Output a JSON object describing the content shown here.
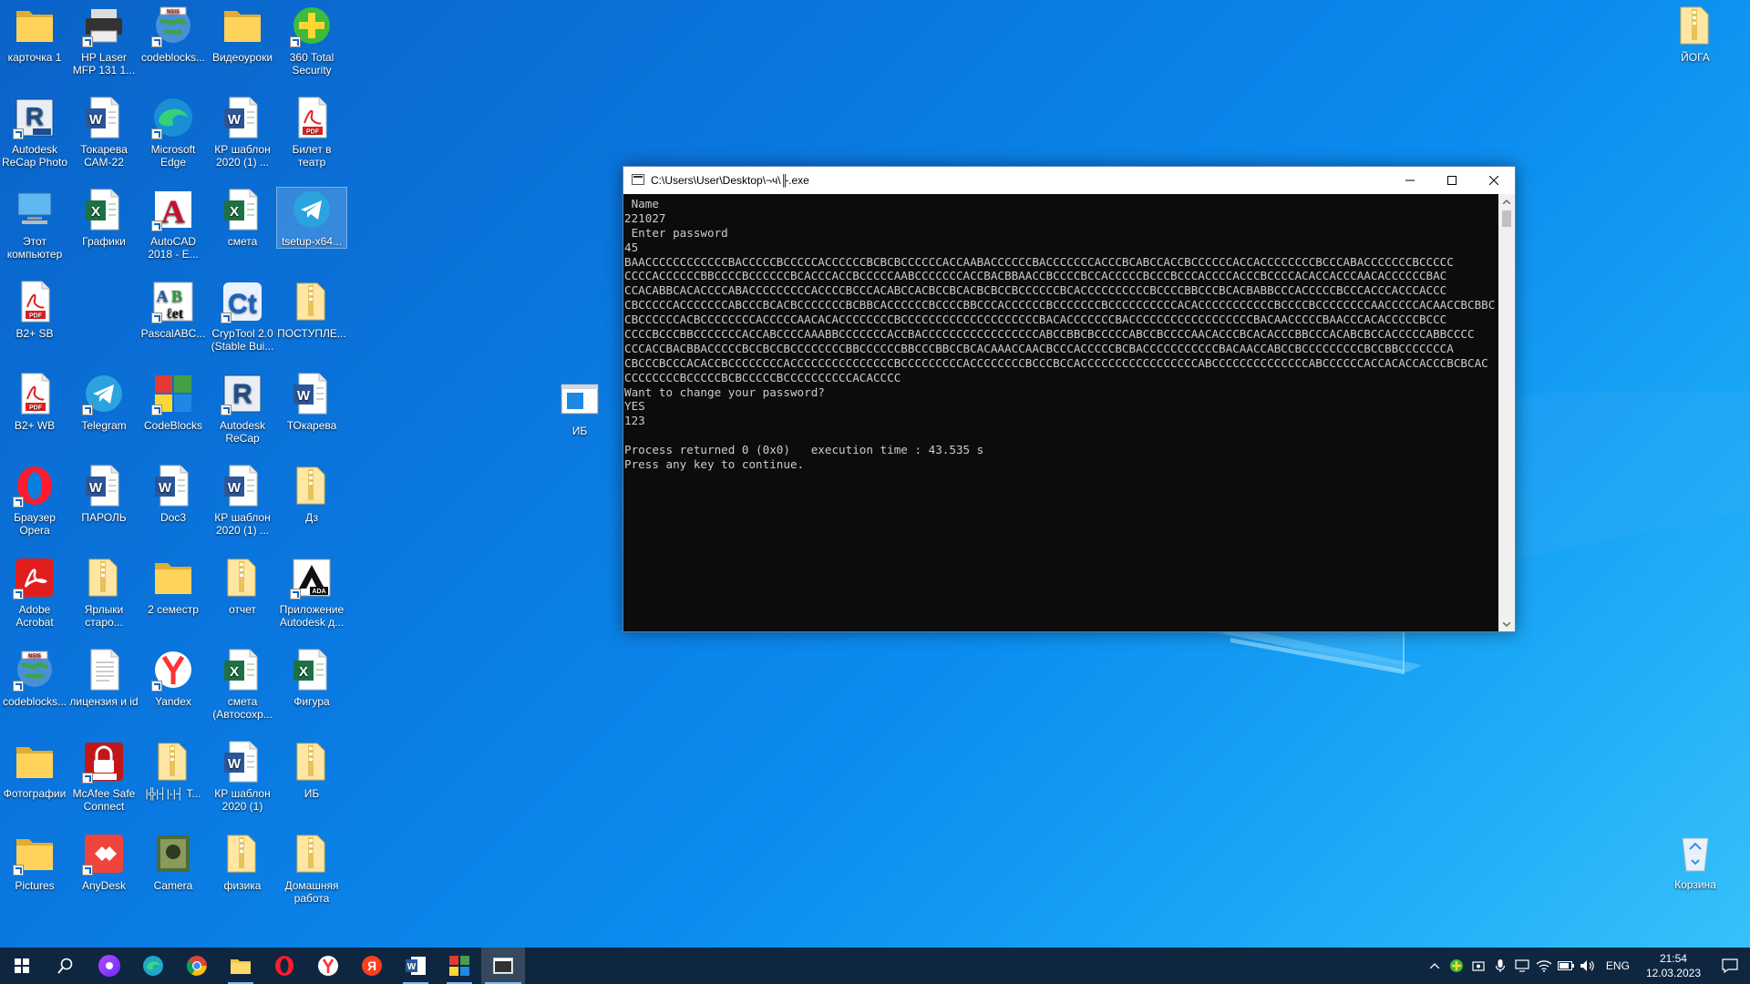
{
  "desktop": {
    "icons": [
      {
        "label": "карточка 1",
        "icon": "folder-icon",
        "shortcut": false
      },
      {
        "label": "HP Laser MFP 131 1...",
        "icon": "printer-icon",
        "shortcut": true
      },
      {
        "label": "codeblocks...",
        "icon": "globe-icon",
        "shortcut": true
      },
      {
        "label": "Видеоуроки",
        "icon": "folder-icon",
        "shortcut": false
      },
      {
        "label": "360 Total Security",
        "icon": "security-360-icon",
        "shortcut": true
      },
      {
        "label": "Autodesk ReCap Photo",
        "icon": "recap-photo-icon",
        "shortcut": true
      },
      {
        "label": "Токарева САМ-22",
        "icon": "word-doc-icon",
        "shortcut": false
      },
      {
        "label": "Microsoft Edge",
        "icon": "edge-icon",
        "shortcut": true
      },
      {
        "label": "КР шаблон 2020 (1) ...",
        "icon": "word-doc-icon",
        "shortcut": false
      },
      {
        "label": "Билет в театр",
        "icon": "pdf-icon",
        "shortcut": false
      },
      {
        "label": "Этот компьютер",
        "icon": "this-pc-icon",
        "shortcut": false
      },
      {
        "label": "Графики",
        "icon": "excel-icon",
        "shortcut": false
      },
      {
        "label": "AutoCAD 2018 - Е...",
        "icon": "autocad-icon",
        "shortcut": true
      },
      {
        "label": "смета",
        "icon": "excel-icon",
        "shortcut": false
      },
      {
        "label": "tsetup-x64...",
        "icon": "telegram-icon",
        "shortcut": false
      },
      {
        "label": "В2+ SB",
        "icon": "pdf-icon",
        "shortcut": false
      },
      {
        "label": "PascalABC...",
        "icon": "pascal-icon",
        "shortcut": true
      },
      {
        "label": "CrypTool 2.0 (Stable Bui...",
        "icon": "cryptool-icon",
        "shortcut": true
      },
      {
        "label": "ПОСТУПЛЕ...",
        "icon": "zip-folder-icon",
        "shortcut": false
      },
      {
        "label": "В2+ WB",
        "icon": "pdf-icon",
        "shortcut": false
      },
      {
        "label": "Telegram",
        "icon": "telegram-icon",
        "shortcut": true
      },
      {
        "label": "CodeBlocks",
        "icon": "codeblocks-icon",
        "shortcut": true
      },
      {
        "label": "Autodesk ReCap",
        "icon": "recap-icon",
        "shortcut": true
      },
      {
        "label": "ТОкарева",
        "icon": "word-doc-icon",
        "shortcut": false
      },
      {
        "label": "ИБ",
        "icon": "window-icon",
        "shortcut": false
      },
      {
        "label": "Браузер Opera",
        "icon": "opera-icon",
        "shortcut": true
      },
      {
        "label": "ПАРОЛЬ",
        "icon": "word-doc-icon",
        "shortcut": false
      },
      {
        "label": "Doc3",
        "icon": "word-doc-icon",
        "shortcut": false
      },
      {
        "label": "КР шаблон 2020 (1) ...",
        "icon": "word-doc-icon",
        "shortcut": false
      },
      {
        "label": "Дз",
        "icon": "zip-folder-icon",
        "shortcut": false
      },
      {
        "label": "Adobe Acrobat",
        "icon": "acrobat-icon",
        "shortcut": true
      },
      {
        "label": "Ярлыки старо...",
        "icon": "zip-folder-icon",
        "shortcut": false
      },
      {
        "label": "2 семестр",
        "icon": "folder-icon",
        "shortcut": false
      },
      {
        "label": "отчет",
        "icon": "zip-folder-icon",
        "shortcut": false
      },
      {
        "label": "Приложение Autodesk д...",
        "icon": "autodesk-app-icon",
        "shortcut": true
      },
      {
        "label": "codeblocks...",
        "icon": "globe-icon",
        "shortcut": true
      },
      {
        "label": "лицензия и id",
        "icon": "text-file-icon",
        "shortcut": false
      },
      {
        "label": "Yandex",
        "icon": "yandex-icon",
        "shortcut": true
      },
      {
        "label": "смета (Автосохр...",
        "icon": "excel-icon",
        "shortcut": false
      },
      {
        "label": "Фигура",
        "icon": "excel-icon",
        "shortcut": false
      },
      {
        "label": "Фотографии",
        "icon": "folder-icon",
        "shortcut": false
      },
      {
        "label": "McAfee Safe Connect",
        "icon": "mcafee-icon",
        "shortcut": true
      },
      {
        "label": "|╬|┤|-|┤ T...",
        "icon": "zip-folder-icon",
        "shortcut": false
      },
      {
        "label": "КР шаблон 2020 (1)",
        "icon": "word-doc-icon",
        "shortcut": false
      },
      {
        "label": "ИБ",
        "icon": "zip-folder-icon",
        "shortcut": false
      },
      {
        "label": "Pictures",
        "icon": "folder-icon",
        "shortcut": true
      },
      {
        "label": "AnyDesk",
        "icon": "anydesk-icon",
        "shortcut": true
      },
      {
        "label": "Camera",
        "icon": "camera-icon",
        "shortcut": false
      },
      {
        "label": "физика",
        "icon": "zip-folder-icon",
        "shortcut": false
      },
      {
        "label": "Домашняя работа",
        "icon": "zip-folder-icon",
        "shortcut": false
      },
      {
        "label": "ЙОГА",
        "icon": "zip-folder-icon",
        "shortcut": false
      },
      {
        "label": "Корзина",
        "icon": "recycle-bin-icon",
        "shortcut": false
      }
    ]
  },
  "console": {
    "title": "C:\\Users\\User\\Desktop\\¬ч\\╟.exe",
    "lines": [
      " Name",
      "221027",
      " Enter password",
      "45",
      "BAACCCCCCCCCCCCBACCCCCBCCCCCACCCCCCBCBCBCCCCCCACCAABACCCCCCBACCCCCCCACCCBCABCCACCBCCCCCCACCACCCCCCCCBCCCABACCCCCCCBCCCCC",
      "CCCCACCCCCCBBCCCCBCCCCCCBCACCCACCBCCCCCAABCCCCCCCACCBACBBAACCBCCCCBCCACCCCCBCCCBCCCACCCCACCCBCCCCACACCACCCAACACCCCCCBAC",
      "CCACABBCACACCCCABACCCCCCCCCACCCCBCCCACABCCACBCCBCACBCBCCBCCCCCCBCACCCCCCCCCCBCCCCBBCCCBCACBABBCCCACCCCCBCCCACCCACCCACCC",
      "CBCCCCCACCCCCCCABCCCBCACBCCCCCCCBCBBCACCCCCCBCCCCBBCCCACCCCCCBCCCCCCCBCCCCCCCCCCACACCCCCCCCCCCBCCCCBCCCCCCCCAACCCCCACAACCBCBBC",
      "CBCCCCCCACBCCCCCCCCACCCCCAACACACCCCCCCCBCCCCCCCCCCCCCCCCCCCCBACACCCCCCCBACCCCCCCCCCCCCCCCCCBACAACCCCCBAACCCACACCCCCBCCC",
      "CCCCBCCCBBCCCCCCCACCABCCCCAAABBCCCCCCCACCBACCCCCCCCCCCCCCCCCABCCBBCBCCCCCABCCBCCCCAACACCCBCACACCCBBCCCACABCBCCACCCCCABBCCCC",
      "CCCACCBACBBACCCCCBCCBCCBCCCCCCCCBBCCCCCCBBCCCBBCCBCACAAACCAACBCCCACCCCCBCBACCCCCCCCCCCBACAACCABCCBCCCCCCCCCBCCBBCCCCCCCA",
      "CBCCCBCCCACACCBCCCCCCCCACCCCCCCCCCCCCCCBCCCCCCCCCACCCCCCCCBCCCBCCACCCCCCCCCCCCCCCCCABCCCCCCCCCCCCCCABCCCCCCACCACACCACCCBCBCAC",
      "CCCCCCCCBCCCCCBCBCCCCCBCCCCCCCCCCACACCCC",
      "Want to change your password?",
      "YES",
      "123",
      "",
      "Process returned 0 (0x0)   execution time : 43.535 s",
      "Press any key to continue."
    ]
  },
  "taskbar": {
    "items": [
      {
        "name": "start-button",
        "icon": "windows-logo-icon"
      },
      {
        "name": "search-button",
        "icon": "search-icon"
      },
      {
        "name": "alice-button",
        "icon": "alice-icon"
      },
      {
        "name": "edge-taskbar",
        "icon": "edge-icon"
      },
      {
        "name": "chrome-taskbar",
        "icon": "chrome-icon"
      },
      {
        "name": "explorer-taskbar",
        "icon": "folder-icon"
      },
      {
        "name": "opera-taskbar",
        "icon": "opera-icon"
      },
      {
        "name": "yandex-taskbar",
        "icon": "yandex-icon"
      },
      {
        "name": "yandex-browser-taskbar",
        "icon": "yandex-browser-icon"
      },
      {
        "name": "word-taskbar",
        "icon": "word-icon"
      },
      {
        "name": "codeblocks-taskbar",
        "icon": "codeblocks-icon"
      },
      {
        "name": "console-taskbar",
        "icon": "console-icon"
      }
    ],
    "language": "ENG",
    "time": "21:54",
    "date": "12.03.2023"
  }
}
